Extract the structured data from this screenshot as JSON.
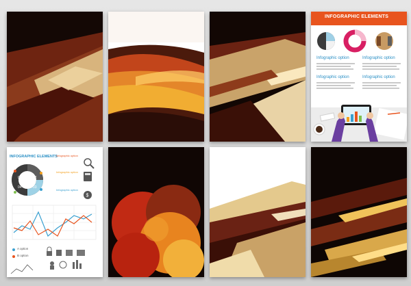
{
  "top_right_card": {
    "title": "INFOGRAPHIC ELEMENTS",
    "pie_letters": [
      "A",
      "B",
      "C"
    ],
    "ring_numbers": [
      "1",
      "2",
      "3"
    ],
    "bar_romans": [
      "I",
      "II"
    ],
    "options": [
      "Infographic option",
      "Infographic option",
      "Infographic option",
      "Infographic option"
    ]
  },
  "bottom_left_card": {
    "title": "INFOGRAPHIC ELEMENTS",
    "side_options": [
      "Infographic option",
      "Infographic option",
      "Infographic option"
    ],
    "donut_numbers": [
      "01",
      "02",
      "03",
      "04"
    ],
    "legend": [
      {
        "letter": "A",
        "text": "option"
      },
      {
        "letter": "B",
        "text": "option"
      }
    ]
  },
  "colors": {
    "accent_orange": "#e8541e",
    "infographic_blue": "#2a8fc5",
    "brand_dark_brown": "#5a1a0c"
  },
  "icons": [
    "magnifier-icon",
    "calculator-icon",
    "dollar-icon",
    "tablet-icon",
    "coffee-cup-icon",
    "lock-icon",
    "thumb-icon"
  ]
}
